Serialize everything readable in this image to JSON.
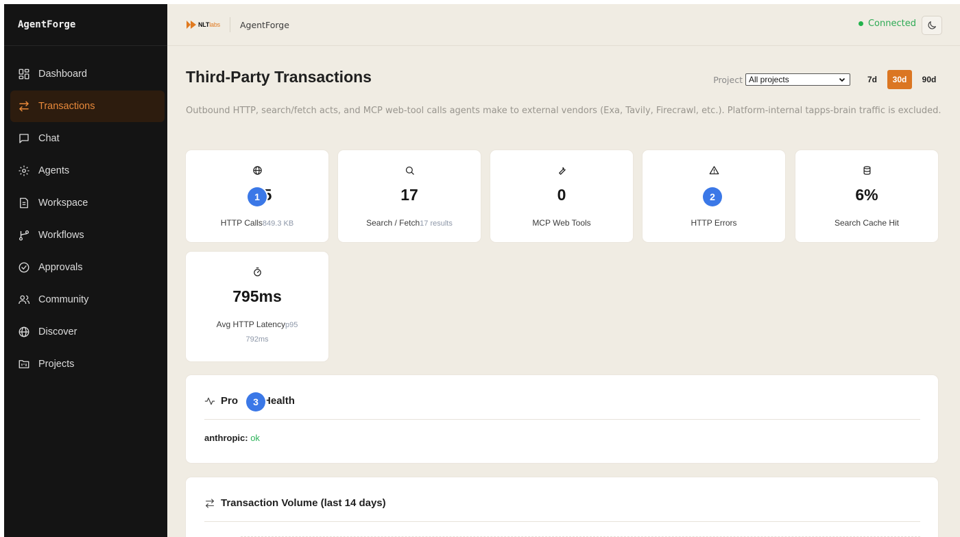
{
  "sidebar": {
    "brand": "AgentForge",
    "items": [
      {
        "label": "Dashboard",
        "icon": "dashboard-grid-icon"
      },
      {
        "label": "Transactions",
        "icon": "arrows-exchange-icon",
        "active": true
      },
      {
        "label": "Chat",
        "icon": "chat-bubble-icon"
      },
      {
        "label": "Agents",
        "icon": "gear-icon"
      },
      {
        "label": "Workspace",
        "icon": "document-icon"
      },
      {
        "label": "Workflows",
        "icon": "git-branch-icon"
      },
      {
        "label": "Approvals",
        "icon": "check-circle-icon"
      },
      {
        "label": "Community",
        "icon": "users-icon"
      },
      {
        "label": "Discover",
        "icon": "globe-icon"
      },
      {
        "label": "Projects",
        "icon": "folder-kanban-icon"
      }
    ]
  },
  "topbar": {
    "logo_text": "NLT",
    "logo_suffix": "labs",
    "app_name": "AgentForge",
    "status": "Connected",
    "theme_icon": "moon-icon"
  },
  "page": {
    "title": "Third-Party Transactions",
    "subtitle": "Outbound HTTP, search/fetch acts, and MCP web-tool calls agents make to external vendors (Exa, Tavily, Firecrawl, etc.). Platform-internal tapps-brain traffic is excluded.",
    "filters": {
      "project_label": "Project",
      "project_selected": "All projects",
      "ranges": [
        "7d",
        "30d",
        "90d"
      ],
      "active_range": "30d"
    }
  },
  "stats": [
    {
      "icon": "globe-icon",
      "value": "5",
      "label": "HTTP Calls",
      "sub": "849.3 KB"
    },
    {
      "icon": "search-icon",
      "value": "17",
      "label": "Search / Fetch",
      "sub": "17 results"
    },
    {
      "icon": "wrench-icon",
      "value": "0",
      "label": "MCP Web Tools",
      "sub": ""
    },
    {
      "icon": "alert-triangle-icon",
      "value": "",
      "label": "HTTP Errors",
      "sub": ""
    },
    {
      "icon": "database-icon",
      "value": "6%",
      "label": "Search Cache Hit",
      "sub": ""
    },
    {
      "icon": "stopwatch-icon",
      "value": "795ms",
      "label": "Avg HTTP Latency",
      "sub": "p95",
      "sub2": "792ms"
    }
  ],
  "provider_health": {
    "title_start": "Pro",
    "title_end": "r Health",
    "provider": "anthropic:",
    "status": "ok"
  },
  "volume": {
    "title": "Transaction Volume (last 14 days)"
  },
  "markers": [
    "1",
    "2",
    "3"
  ],
  "colors": {
    "accent": "#db7622",
    "sidebar_bg": "#141414",
    "main_bg": "#f0ece3",
    "ok_green": "#2db35a",
    "marker_blue": "#3b78e7"
  }
}
